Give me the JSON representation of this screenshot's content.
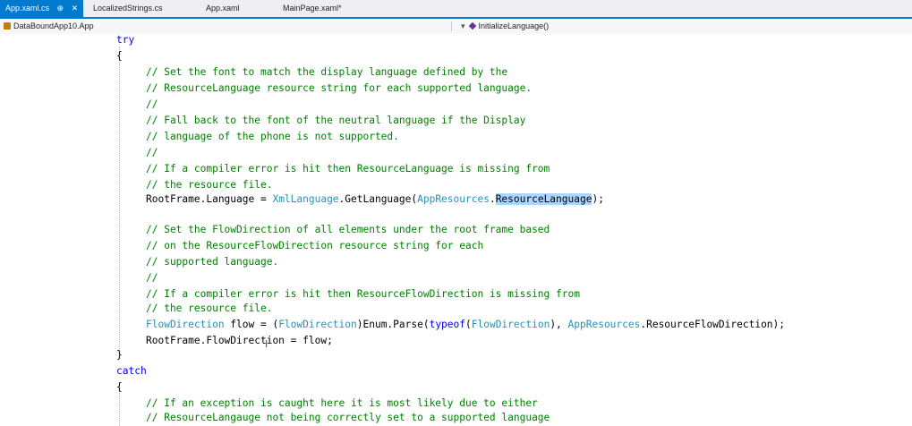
{
  "tabs": [
    {
      "label": "App.xaml.cs",
      "pin": "⊕",
      "close": "✕",
      "active": true
    },
    {
      "label": "LocalizedStrings.cs",
      "active": false
    },
    {
      "label": "App.xaml",
      "active": false
    },
    {
      "label": "MainPage.xaml*",
      "active": false
    }
  ],
  "navbar": {
    "class_scope": "DataBoundApp10.App",
    "member_scope": "InitializeLanguage()",
    "dropdown_arrow": "▾"
  },
  "code": {
    "l0": "try",
    "l1": "{",
    "l2": "// Set the font to match the display language defined by the",
    "l3": "// ResourceLanguage resource string for each supported language.",
    "l4": "//",
    "l5": "// Fall back to the font of the neutral language if the Display",
    "l6": "// language of the phone is not supported.",
    "l7": "//",
    "l8": "// If a compiler error is hit then ResourceLanguage is missing from",
    "l9": "// the resource file.",
    "l10": {
      "a": "RootFrame.Language = ",
      "b": "XmlLanguage",
      "c": ".GetLanguage(",
      "d": "AppResources",
      "e": ".",
      "f": "ResourceLanguage",
      "g": ");"
    },
    "l12": "// Set the FlowDirection of all elements under the root frame based",
    "l13": "// on the ResourceFlowDirection resource string for each",
    "l14": "// supported language.",
    "l15": "//",
    "l16": "// If a compiler error is hit then ResourceFlowDirection is missing from",
    "l17": "// the resource file.",
    "l18": {
      "a": "FlowDirection",
      "b": " flow = (",
      "c": "FlowDirection",
      "d": ")Enum.Parse(",
      "e": "typeof",
      "f": "(",
      "g": "FlowDirection",
      "h": "), ",
      "i": "AppResources",
      "j": ".ResourceFlowDirection);"
    },
    "l19": "RootFrame.FlowDirection = flow;",
    "l20": "}",
    "l21": "catch",
    "l22": "{",
    "l23": "// If an exception is caught here it is most likely due to either",
    "l24": "// ResourceLangauge not being correctly set to a supported language"
  },
  "colors": {
    "comment": "#008000",
    "keyword": "#0000ff",
    "type": "#2b91af",
    "selection": "#add6ff",
    "tab_active": "#007acc"
  },
  "icons": {
    "class_scope": "class-icon",
    "member_scope": "method-icon",
    "cursor": "i-beam-cursor-icon"
  }
}
